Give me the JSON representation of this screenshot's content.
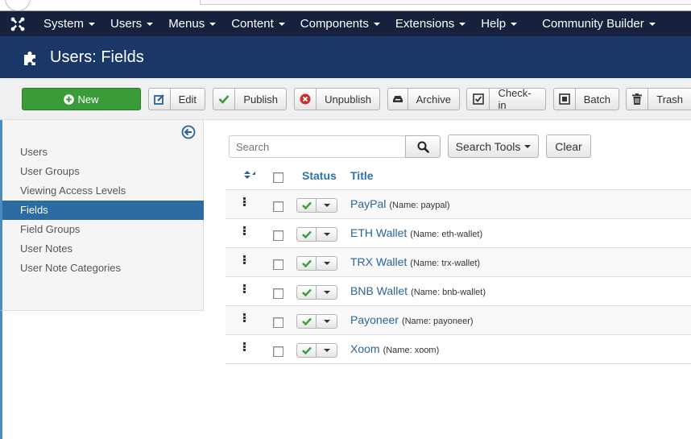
{
  "nav": {
    "items": [
      {
        "label": "System"
      },
      {
        "label": "Users"
      },
      {
        "label": "Menus"
      },
      {
        "label": "Content"
      },
      {
        "label": "Components"
      },
      {
        "label": "Extensions"
      },
      {
        "label": "Help"
      },
      {
        "label": "Community Builder"
      }
    ]
  },
  "header": {
    "title": "Users: Fields"
  },
  "toolbar": {
    "new": "New",
    "edit": "Edit",
    "publish": "Publish",
    "unpublish": "Unpublish",
    "archive": "Archive",
    "checkin": "Check-in",
    "batch": "Batch",
    "trash": "Trash"
  },
  "sidebar": {
    "items": [
      {
        "label": "Users"
      },
      {
        "label": "User Groups"
      },
      {
        "label": "Viewing Access Levels"
      },
      {
        "label": "Fields",
        "active": true
      },
      {
        "label": "Field Groups"
      },
      {
        "label": "User Notes"
      },
      {
        "label": "User Note Categories"
      }
    ]
  },
  "filters": {
    "search_placeholder": "Search",
    "search_tools": "Search Tools",
    "clear": "Clear"
  },
  "table": {
    "headers": {
      "status": "Status",
      "title": "Title"
    },
    "rows": [
      {
        "title": "PayPal",
        "meta": "(Name: paypal)"
      },
      {
        "title": "ETH Wallet",
        "meta": "(Name: eth-wallet)"
      },
      {
        "title": "TRX Wallet",
        "meta": "(Name: trx-wallet)"
      },
      {
        "title": "BNB Wallet",
        "meta": "(Name: bnb-wallet)"
      },
      {
        "title": "Payoneer",
        "meta": "(Name: payoneer)"
      },
      {
        "title": "Xoom",
        "meta": "(Name: xoom)"
      }
    ]
  },
  "colors": {
    "navbar": "#17203c",
    "header": "#1a3867",
    "new_button": "#3a9b39",
    "sidebar_active": "#2d6ca2",
    "link": "#2a6496",
    "published_check": "#3a9b39",
    "unpublish_icon": "#c9302c"
  }
}
